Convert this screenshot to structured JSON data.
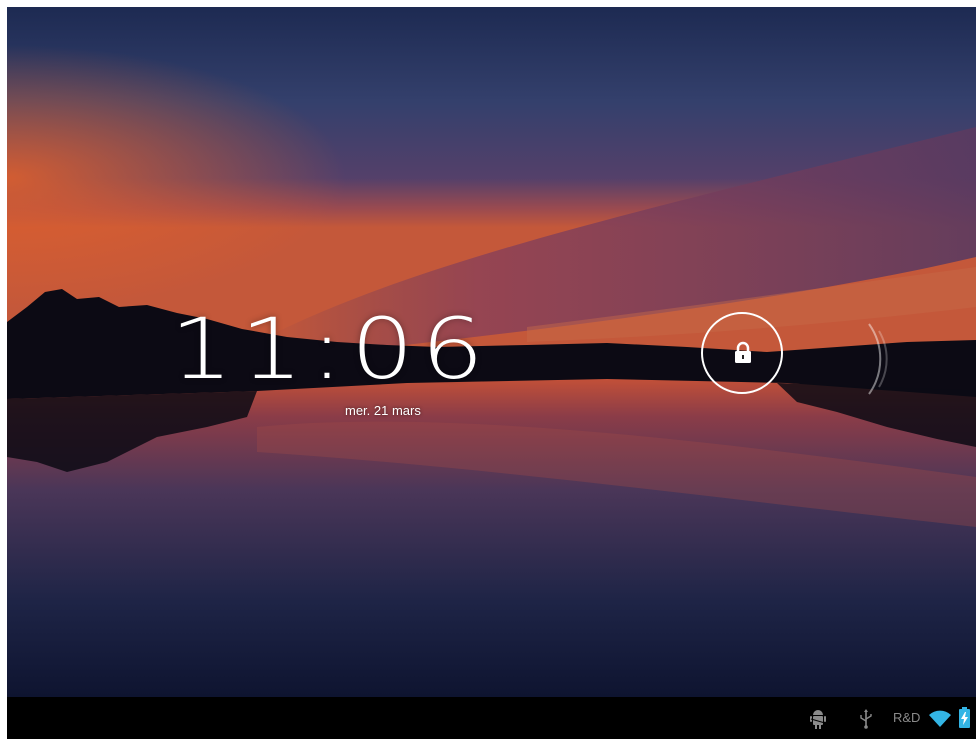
{
  "lockscreen": {
    "time": "11:06",
    "date": "mer. 21 mars"
  },
  "status_bar": {
    "carrier": "R&D",
    "icons": [
      "android-debug-icon",
      "usb-icon",
      "wifi-icon",
      "battery-charging-icon"
    ]
  },
  "colors": {
    "accent_wifi": "#33b5e5",
    "text": "#ffffff",
    "navbar": "#000000"
  }
}
